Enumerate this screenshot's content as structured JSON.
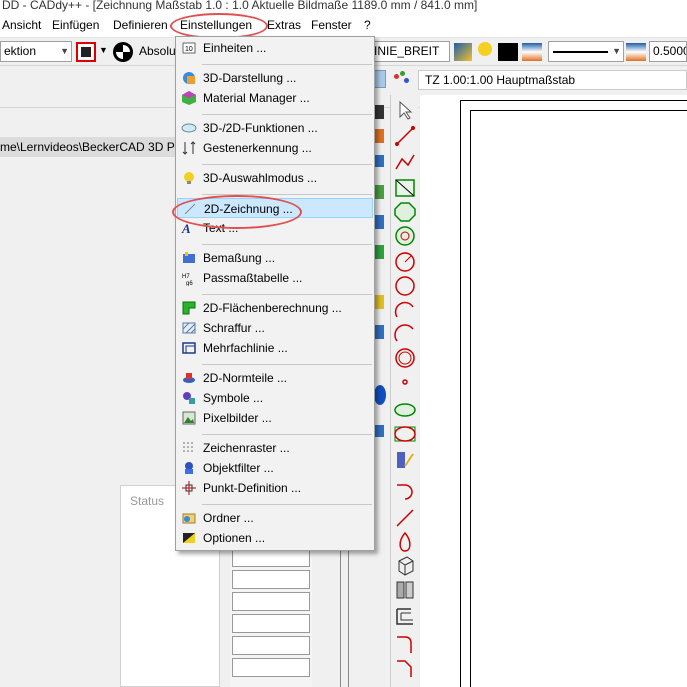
{
  "window": {
    "title": "DD  -  CADdy++ - [Zeichnung    Maßstab 1.0 : 1.0    Aktuelle Bildmaße 1189.0 mm / 841.0 mm]"
  },
  "menubar": {
    "items": [
      "Ansicht",
      "Einfügen",
      "Definieren",
      "Einstellungen",
      "Extras",
      "Fenster",
      "?"
    ],
    "active": "Einstellungen"
  },
  "toolbar": {
    "selection_value": "ektion",
    "absolute_label": "Absolu",
    "linetype_value": "INIE_BREIT",
    "width_value": "0.5000"
  },
  "path": {
    "text": "me\\Lernvideos\\BeckerCAD 3D Pr"
  },
  "status": {
    "label": "Status"
  },
  "drawing": {
    "tz_label": "TZ 1.00:1.00 Hauptmaßstab"
  },
  "dropdown": {
    "items": [
      {
        "label": "Einheiten ...",
        "icon": "units-icon"
      },
      {
        "label": "3D-Darstellung ...",
        "icon": "3d-display-icon"
      },
      {
        "label": "Material Manager ...",
        "icon": "material-icon"
      },
      {
        "label": "3D-/2D-Funktionen ...",
        "icon": "functions-icon"
      },
      {
        "label": "Gestenerkennung ...",
        "icon": "gesture-icon"
      },
      {
        "label": "3D-Auswahlmodus ...",
        "icon": "select-mode-icon"
      },
      {
        "label": "2D-Zeichnung ...",
        "icon": "drawing-2d-icon"
      },
      {
        "label": "Text ...",
        "icon": "text-icon"
      },
      {
        "label": "Bemaßung ...",
        "icon": "dimension-icon"
      },
      {
        "label": "Passmaßtabelle ...",
        "icon": "fit-table-icon"
      },
      {
        "label": "2D-Flächenberechnung ...",
        "icon": "area-calc-icon"
      },
      {
        "label": "Schraffur ...",
        "icon": "hatch-icon"
      },
      {
        "label": "Mehrfachlinie ...",
        "icon": "multiline-icon"
      },
      {
        "label": "2D-Normteile ...",
        "icon": "standard-parts-icon"
      },
      {
        "label": "Symbole ...",
        "icon": "symbols-icon"
      },
      {
        "label": "Pixelbilder ...",
        "icon": "pixel-images-icon"
      },
      {
        "label": "Zeichenraster ...",
        "icon": "grid-icon"
      },
      {
        "label": "Objektfilter ...",
        "icon": "object-filter-icon"
      },
      {
        "label": "Punkt-Definition ...",
        "icon": "point-definition-icon"
      },
      {
        "label": "Ordner ...",
        "icon": "folder-icon"
      },
      {
        "label": "Optionen ...",
        "icon": "options-icon"
      }
    ],
    "highlighted": "2D-Zeichnung ..."
  },
  "colors": {
    "highlight_bg": "#cce8ff",
    "annotation_red": "#e05050"
  }
}
